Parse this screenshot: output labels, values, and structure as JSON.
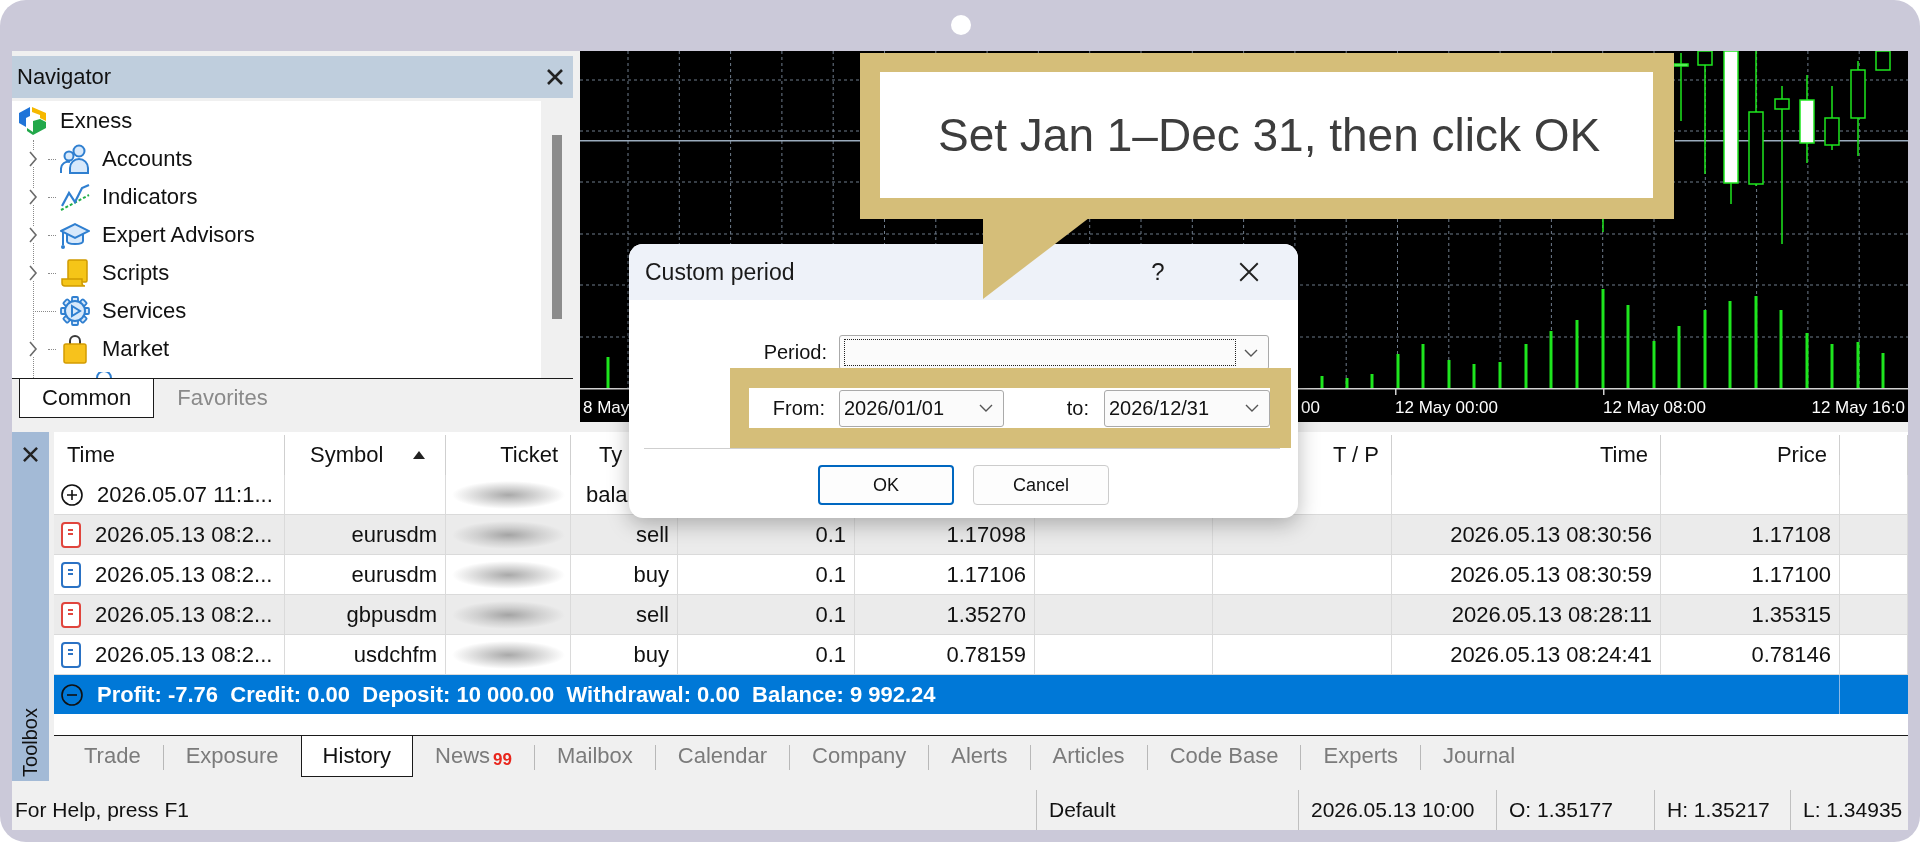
{
  "navigator": {
    "title": "Navigator",
    "tree": [
      {
        "label": "Exness",
        "children": [
          {
            "label": "Accounts",
            "expanded": false
          },
          {
            "label": "Indicators",
            "expanded": false
          },
          {
            "label": "Expert Advisors",
            "expanded": false
          },
          {
            "label": "Scripts",
            "expanded": false
          },
          {
            "label": "Services"
          },
          {
            "label": "Market",
            "expanded": false
          }
        ]
      }
    ],
    "tabs": [
      {
        "label": "Common",
        "selected": true
      },
      {
        "label": "Favorites",
        "selected": false
      }
    ]
  },
  "chart": {
    "time_labels": [
      "8 May",
      "00",
      "12 May 00:00",
      "12 May 08:00",
      "12 May 16:0"
    ]
  },
  "callout": {
    "text": "Set Jan 1–Dec 31, then click OK"
  },
  "dialog": {
    "title": "Custom period",
    "help": "?",
    "period_label": "Period:",
    "from_label": "From:",
    "from_value": "2026/01/01",
    "to_label": "to:",
    "to_value": "2026/12/31",
    "buttons": [
      {
        "label": "OK",
        "default": true
      },
      {
        "label": "Cancel",
        "default": false
      }
    ]
  },
  "toolbox": {
    "title": "Toolbox",
    "table": {
      "header": {
        "time": {
          "label": "Time"
        },
        "symbol": {
          "label": "Symbol",
          "sort_ascending": true
        },
        "ticket": {
          "label": "Ticket"
        },
        "column_4": {
          "label": "Ty"
        },
        "tp": {
          "label": "T / P"
        },
        "time_2": {
          "label": "Time"
        },
        "price": {
          "label": "Price"
        }
      },
      "rows": [
        {
          "kind": "balance",
          "selected": false,
          "expanded": false,
          "time": "2026.05.07 11:1...",
          "column_4": "bala"
        },
        {
          "kind": "sell",
          "selected": false,
          "time": "2026.05.13 08:2...",
          "symbol": "eurusdm",
          "column_4": "sell",
          "column_5": "0.1",
          "column_6": "1.17098",
          "time_2": "2026.05.13 08:30:56",
          "price": "1.17108"
        },
        {
          "kind": "buy",
          "selected": false,
          "time": "2026.05.13 08:2...",
          "symbol": "eurusdm",
          "column_4": "buy",
          "column_5": "0.1",
          "column_6": "1.17106",
          "time_2": "2026.05.13 08:30:59",
          "price": "1.17100"
        },
        {
          "kind": "sell",
          "selected": false,
          "time": "2026.05.13 08:2...",
          "symbol": "gbpusdm",
          "column_4": "sell",
          "column_5": "0.1",
          "column_6": "1.35270",
          "time_2": "2026.05.13 08:28:11",
          "price": "1.35315"
        },
        {
          "kind": "buy",
          "selected": false,
          "time": "2026.05.13 08:2...",
          "symbol": "usdchfm",
          "column_4": "buy",
          "column_5": "0.1",
          "column_6": "0.78159",
          "time_2": "2026.05.13 08:24:41",
          "price": "0.78146"
        },
        {
          "kind": "summary",
          "selected": true,
          "expanded": true,
          "text": "Profit: -7.76  Credit: 0.00  Deposit: 10 000.00  Withdrawal: 0.00  Balance: 9 992.24"
        }
      ]
    },
    "tabs": [
      {
        "label": "Trade",
        "selected": false
      },
      {
        "label": "Exposure",
        "selected": false
      },
      {
        "label": "History",
        "selected": true
      },
      {
        "label": "News",
        "badge": "99",
        "selected": false
      },
      {
        "label": "Mailbox",
        "selected": false
      },
      {
        "label": "Calendar",
        "selected": false
      },
      {
        "label": "Company",
        "selected": false
      },
      {
        "label": "Alerts",
        "selected": false
      },
      {
        "label": "Articles",
        "selected": false
      },
      {
        "label": "Code Base",
        "selected": false
      },
      {
        "label": "Experts",
        "selected": false
      },
      {
        "label": "Journal",
        "selected": false
      }
    ]
  },
  "status_bar": [
    "For Help, press F1",
    "Default",
    "2026.05.13 10:00",
    "O: 1.35177",
    "H: 1.35217",
    "L: 1.34935"
  ]
}
